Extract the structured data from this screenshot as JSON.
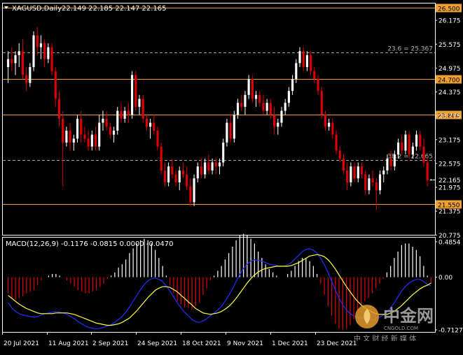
{
  "header": {
    "symbol_tf": "XAGUSD,Daily",
    "ohlc": "22.149 22.185 22.147 22.165"
  },
  "macd": {
    "label": "MACD(12,26,9) -0.1176 -0.0815 0.0000 -0.0470",
    "yticks": [
      "0.4854",
      "0.00",
      "-0.7127"
    ]
  },
  "watermark": {
    "brand": "中金网",
    "domain": "CNGOLD.COM",
    "slogan": "中 文 财 经 新 媒 体"
  },
  "colors": {
    "background": "#000000",
    "bull": "#ffffff",
    "bear": "#e00000",
    "level_line": "#f0a030",
    "fib_line": "#a0a0a0",
    "macd_line": "#2030ff",
    "signal_line": "#ffff40",
    "hist_pos": "#ffffff",
    "hist_neg": "#e00000",
    "axis": "#ffffff"
  },
  "chart_data": {
    "type": "candlestick",
    "price_axis": {
      "ymin": 20.78,
      "ymax": 26.6,
      "ticks": [
        "26.175",
        "25.575",
        "24.975",
        "24.375",
        "23.775",
        "23.175",
        "22.575",
        "21.975",
        "21.375",
        "20.775"
      ]
    },
    "horizontal_levels": [
      {
        "price": 26.5,
        "label": "26.500"
      },
      {
        "price": 24.7,
        "label": "24.700"
      },
      {
        "price": 23.8,
        "label": "23.800"
      },
      {
        "price": 21.55,
        "label": "21.550"
      }
    ],
    "fib_levels": [
      {
        "price": 25.367,
        "label": "23.6 = 25.367"
      },
      {
        "price": 22.665,
        "label": "38.2 = 22.665"
      }
    ],
    "last_price": {
      "price": 22.165,
      "label": "22.165"
    },
    "x_labels": [
      "20 Jul 2021",
      "11 Aug 2021",
      "2 Sep 2021",
      "24 Sep 2021",
      "18 Oct 2021",
      "9 Nov 2021",
      "1 Dec 2021",
      "23 Dec 2021"
    ],
    "candles": [
      [
        25.0,
        25.4,
        24.6,
        25.2
      ],
      [
        25.2,
        25.5,
        24.9,
        25.1
      ],
      [
        25.1,
        25.4,
        24.8,
        25.3
      ],
      [
        25.3,
        25.6,
        25.0,
        25.4
      ],
      [
        25.4,
        25.7,
        24.7,
        24.8
      ],
      [
        24.8,
        25.0,
        24.4,
        24.6
      ],
      [
        24.6,
        25.1,
        24.5,
        25.0
      ],
      [
        25.0,
        25.9,
        24.9,
        25.8
      ],
      [
        25.8,
        26.0,
        25.3,
        25.5
      ],
      [
        25.5,
        25.8,
        25.2,
        25.6
      ],
      [
        25.6,
        25.7,
        25.0,
        25.2
      ],
      [
        25.2,
        25.6,
        25.1,
        25.5
      ],
      [
        25.5,
        25.6,
        24.8,
        24.9
      ],
      [
        24.9,
        25.0,
        24.0,
        24.2
      ],
      [
        24.2,
        24.4,
        23.5,
        23.7
      ],
      [
        23.7,
        23.9,
        22.0,
        23.1
      ],
      [
        23.1,
        23.5,
        23.0,
        23.4
      ],
      [
        23.4,
        23.6,
        22.9,
        23.1
      ],
      [
        23.1,
        23.3,
        22.9,
        23.2
      ],
      [
        23.2,
        23.8,
        23.1,
        23.7
      ],
      [
        23.7,
        23.9,
        23.1,
        23.3
      ],
      [
        23.3,
        23.5,
        23.1,
        23.2
      ],
      [
        23.2,
        23.4,
        22.9,
        23.0
      ],
      [
        23.0,
        23.4,
        22.9,
        23.3
      ],
      [
        23.3,
        23.5,
        22.9,
        23.0
      ],
      [
        23.0,
        23.8,
        22.9,
        23.6
      ],
      [
        23.6,
        23.9,
        23.4,
        23.7
      ],
      [
        23.7,
        23.9,
        23.4,
        23.5
      ],
      [
        23.5,
        23.6,
        23.2,
        23.3
      ],
      [
        23.3,
        23.5,
        23.1,
        23.4
      ],
      [
        23.4,
        24.0,
        23.3,
        23.9
      ],
      [
        23.9,
        24.1,
        23.6,
        23.7
      ],
      [
        23.7,
        24.0,
        23.6,
        23.9
      ],
      [
        23.9,
        24.1,
        23.6,
        23.8
      ],
      [
        23.8,
        24.9,
        23.7,
        24.8
      ],
      [
        24.8,
        24.9,
        23.9,
        24.0
      ],
      [
        24.0,
        24.3,
        23.8,
        24.2
      ],
      [
        24.2,
        24.3,
        23.6,
        23.7
      ],
      [
        23.7,
        23.8,
        23.4,
        23.5
      ],
      [
        23.5,
        23.7,
        23.2,
        23.6
      ],
      [
        23.6,
        23.8,
        23.3,
        23.4
      ],
      [
        23.4,
        23.5,
        22.9,
        23.0
      ],
      [
        23.0,
        23.1,
        22.3,
        22.4
      ],
      [
        22.4,
        22.6,
        22.0,
        22.1
      ],
      [
        22.1,
        22.6,
        22.0,
        22.5
      ],
      [
        22.5,
        22.7,
        22.2,
        22.3
      ],
      [
        22.3,
        22.4,
        22.0,
        22.1
      ],
      [
        22.1,
        22.5,
        21.9,
        22.4
      ],
      [
        22.4,
        22.6,
        22.2,
        22.3
      ],
      [
        22.3,
        22.5,
        21.9,
        22.0
      ],
      [
        22.0,
        22.2,
        21.5,
        21.6
      ],
      [
        21.6,
        22.3,
        21.5,
        22.2
      ],
      [
        22.2,
        22.6,
        22.1,
        22.5
      ],
      [
        22.5,
        22.7,
        22.2,
        22.3
      ],
      [
        22.3,
        22.7,
        22.2,
        22.6
      ],
      [
        22.6,
        22.8,
        22.3,
        22.4
      ],
      [
        22.4,
        22.7,
        22.3,
        22.6
      ],
      [
        22.6,
        22.7,
        22.3,
        22.5
      ],
      [
        22.5,
        22.7,
        22.3,
        22.6
      ],
      [
        22.6,
        23.2,
        22.5,
        23.1
      ],
      [
        23.1,
        23.7,
        23.0,
        23.6
      ],
      [
        23.6,
        23.8,
        23.1,
        23.2
      ],
      [
        23.2,
        23.9,
        23.1,
        23.8
      ],
      [
        23.8,
        24.2,
        23.7,
        24.1
      ],
      [
        24.1,
        24.3,
        23.9,
        24.0
      ],
      [
        24.0,
        24.4,
        23.8,
        24.3
      ],
      [
        24.3,
        24.8,
        24.2,
        24.7
      ],
      [
        24.7,
        24.8,
        24.1,
        24.2
      ],
      [
        24.2,
        24.4,
        24.0,
        24.3
      ],
      [
        24.3,
        24.4,
        24.0,
        24.1
      ],
      [
        24.1,
        24.3,
        23.8,
        23.9
      ],
      [
        23.9,
        24.2,
        23.8,
        24.1
      ],
      [
        24.1,
        24.2,
        23.7,
        23.8
      ],
      [
        23.8,
        24.0,
        23.3,
        23.5
      ],
      [
        23.5,
        23.7,
        23.3,
        23.6
      ],
      [
        23.6,
        24.0,
        23.5,
        23.9
      ],
      [
        23.9,
        24.2,
        23.8,
        24.1
      ],
      [
        24.1,
        24.5,
        24.0,
        24.4
      ],
      [
        24.4,
        24.8,
        24.3,
        24.7
      ],
      [
        24.7,
        25.2,
        24.6,
        25.1
      ],
      [
        25.1,
        25.5,
        25.0,
        25.4
      ],
      [
        25.4,
        25.5,
        24.9,
        25.0
      ],
      [
        25.0,
        25.4,
        24.9,
        25.3
      ],
      [
        25.3,
        25.4,
        24.8,
        24.9
      ],
      [
        24.9,
        25.0,
        24.6,
        24.7
      ],
      [
        24.7,
        24.8,
        24.3,
        24.4
      ],
      [
        24.4,
        24.5,
        23.7,
        23.8
      ],
      [
        23.8,
        23.9,
        23.4,
        23.5
      ],
      [
        23.5,
        23.7,
        23.4,
        23.6
      ],
      [
        23.6,
        23.7,
        23.2,
        23.3
      ],
      [
        23.3,
        23.4,
        22.8,
        22.9
      ],
      [
        22.9,
        23.0,
        22.6,
        22.7
      ],
      [
        22.7,
        22.8,
        22.3,
        22.4
      ],
      [
        22.4,
        22.6,
        21.9,
        22.1
      ],
      [
        22.1,
        22.6,
        22.0,
        22.5
      ],
      [
        22.5,
        22.6,
        22.1,
        22.2
      ],
      [
        22.2,
        22.6,
        22.1,
        22.5
      ],
      [
        22.5,
        22.6,
        22.2,
        22.3
      ],
      [
        22.3,
        22.4,
        21.8,
        21.9
      ],
      [
        21.9,
        22.3,
        21.8,
        22.2
      ],
      [
        22.2,
        22.4,
        22.0,
        22.1
      ],
      [
        22.1,
        22.2,
        21.4,
        21.9
      ],
      [
        21.9,
        22.4,
        21.8,
        22.3
      ],
      [
        22.3,
        22.5,
        22.1,
        22.4
      ],
      [
        22.4,
        22.8,
        22.3,
        22.7
      ],
      [
        22.7,
        22.9,
        22.4,
        22.5
      ],
      [
        22.5,
        22.9,
        22.4,
        22.8
      ],
      [
        22.8,
        23.2,
        22.7,
        23.1
      ],
      [
        23.1,
        23.3,
        22.8,
        22.9
      ],
      [
        22.9,
        23.4,
        22.8,
        23.3
      ],
      [
        23.3,
        23.4,
        22.7,
        22.8
      ],
      [
        22.8,
        23.1,
        22.7,
        23.0
      ],
      [
        23.0,
        23.4,
        22.9,
        23.3
      ],
      [
        23.3,
        23.4,
        22.9,
        23.0
      ],
      [
        23.0,
        23.2,
        22.5,
        22.6
      ],
      [
        22.6,
        22.7,
        22.0,
        22.15
      ],
      [
        22.149,
        22.185,
        22.147,
        22.165
      ]
    ],
    "macd_main": [
      -0.35,
      -0.42,
      -0.47,
      -0.5,
      -0.52,
      -0.53,
      -0.54,
      -0.55,
      -0.54,
      -0.52,
      -0.5,
      -0.49,
      -0.48,
      -0.47,
      -0.48,
      -0.49,
      -0.51,
      -0.54,
      -0.57,
      -0.61,
      -0.64,
      -0.67,
      -0.69,
      -0.7,
      -0.71,
      -0.7,
      -0.69,
      -0.67,
      -0.65,
      -0.62,
      -0.58,
      -0.54,
      -0.48,
      -0.41,
      -0.33,
      -0.25,
      -0.17,
      -0.1,
      -0.05,
      -0.02,
      -0.01,
      -0.03,
      -0.06,
      -0.12,
      -0.19,
      -0.27,
      -0.35,
      -0.42,
      -0.48,
      -0.53,
      -0.58,
      -0.61,
      -0.62,
      -0.6,
      -0.57,
      -0.53,
      -0.49,
      -0.45,
      -0.4,
      -0.33,
      -0.25,
      -0.16,
      -0.06,
      0.04,
      0.12,
      0.18,
      0.22,
      0.24,
      0.23,
      0.22,
      0.2,
      0.18,
      0.17,
      0.16,
      0.15,
      0.15,
      0.17,
      0.2,
      0.25,
      0.3,
      0.35,
      0.38,
      0.39,
      0.37,
      0.33,
      0.26,
      0.17,
      0.06,
      -0.06,
      -0.18,
      -0.29,
      -0.38,
      -0.45,
      -0.5,
      -0.53,
      -0.55,
      -0.56,
      -0.57,
      -0.58,
      -0.58,
      -0.57,
      -0.55,
      -0.52,
      -0.48,
      -0.42,
      -0.35,
      -0.27,
      -0.19,
      -0.13,
      -0.08,
      -0.05,
      -0.03,
      -0.03,
      -0.06,
      -0.1,
      -0.12
    ],
    "macd_signal": [
      -0.25,
      -0.29,
      -0.33,
      -0.37,
      -0.4,
      -0.43,
      -0.45,
      -0.47,
      -0.49,
      -0.5,
      -0.5,
      -0.5,
      -0.5,
      -0.49,
      -0.49,
      -0.49,
      -0.49,
      -0.5,
      -0.51,
      -0.53,
      -0.55,
      -0.57,
      -0.59,
      -0.61,
      -0.63,
      -0.64,
      -0.65,
      -0.66,
      -0.66,
      -0.65,
      -0.64,
      -0.62,
      -0.59,
      -0.56,
      -0.51,
      -0.46,
      -0.4,
      -0.34,
      -0.28,
      -0.23,
      -0.18,
      -0.15,
      -0.13,
      -0.13,
      -0.14,
      -0.17,
      -0.2,
      -0.25,
      -0.29,
      -0.34,
      -0.38,
      -0.43,
      -0.46,
      -0.49,
      -0.5,
      -0.51,
      -0.5,
      -0.49,
      -0.47,
      -0.44,
      -0.4,
      -0.35,
      -0.29,
      -0.22,
      -0.15,
      -0.08,
      -0.02,
      0.03,
      0.07,
      0.1,
      0.12,
      0.13,
      0.14,
      0.15,
      0.15,
      0.15,
      0.15,
      0.16,
      0.18,
      0.2,
      0.23,
      0.26,
      0.29,
      0.3,
      0.31,
      0.3,
      0.28,
      0.24,
      0.18,
      0.11,
      0.03,
      -0.05,
      -0.13,
      -0.2,
      -0.27,
      -0.33,
      -0.38,
      -0.42,
      -0.45,
      -0.48,
      -0.5,
      -0.51,
      -0.51,
      -0.51,
      -0.49,
      -0.47,
      -0.43,
      -0.39,
      -0.34,
      -0.29,
      -0.24,
      -0.2,
      -0.16,
      -0.13,
      -0.11,
      -0.08
    ]
  }
}
